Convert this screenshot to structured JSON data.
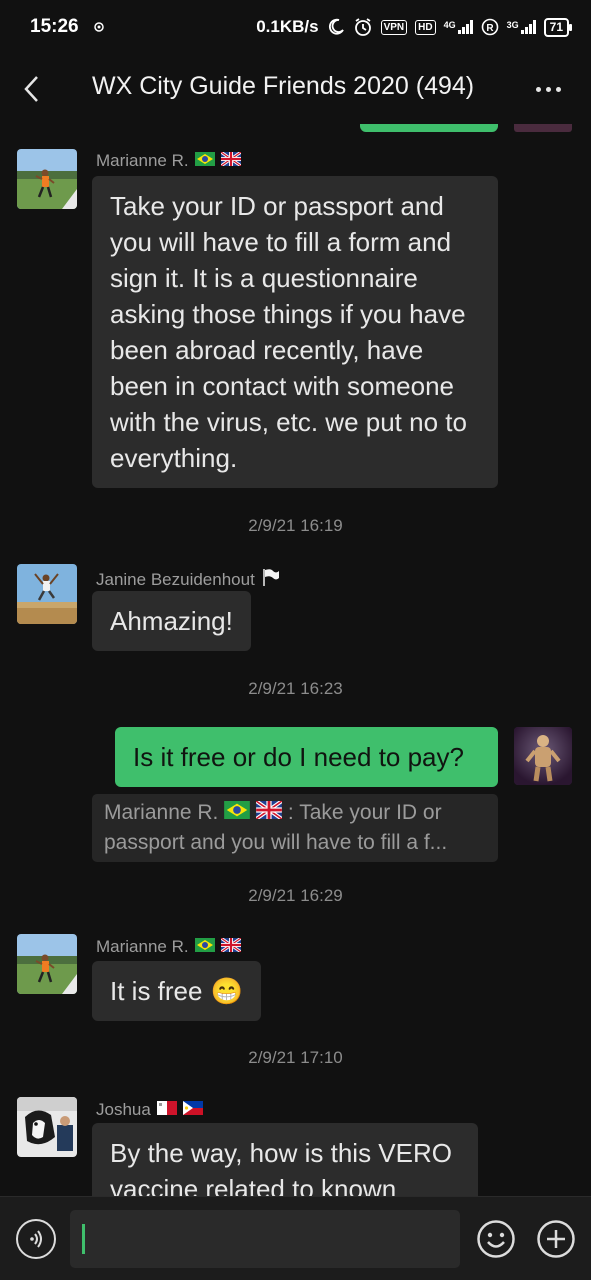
{
  "status_bar": {
    "time": "15:26",
    "speed": "0.1KB/s",
    "vpn": "VPN",
    "hd": "HD",
    "net1": "4G",
    "net2": "3G",
    "battery": "71"
  },
  "header": {
    "title": "WX City Guide Friends 2020 (494)"
  },
  "messages": [
    {
      "sender": "Marianne R.",
      "text": "Take your ID or passport and you will have to fill a form and sign it. It is a questionnaire asking those things if you have been abroad recently, have been in contact with someone with the virus, etc. we put no to everything."
    },
    {
      "timestamp": "2/9/21 16:19",
      "sender": "Janine Bezuidenhout",
      "text": "Ahmazing!"
    },
    {
      "timestamp": "2/9/21 16:23",
      "text": "Is it free or do I need to pay?",
      "quote_sender": "Marianne R.",
      "quote_text": ": Take your ID or passport and you will have to fill a f..."
    },
    {
      "timestamp": "2/9/21 16:29",
      "sender": "Marianne R.",
      "text": "It is free",
      "emoji": "😁"
    },
    {
      "timestamp": "2/9/21 17:10",
      "sender": "Joshua",
      "text": "By the way, how is this VERO vaccine related to known"
    }
  ],
  "colors": {
    "background": "#111111",
    "bubble": "#2c2c2c",
    "accent_green": "#3fbf6c"
  },
  "icons": {
    "back": "chevron-left-icon",
    "more": "more-dots-icon",
    "voice": "voice-icon",
    "emoji": "emoji-icon",
    "plus": "plus-icon"
  }
}
